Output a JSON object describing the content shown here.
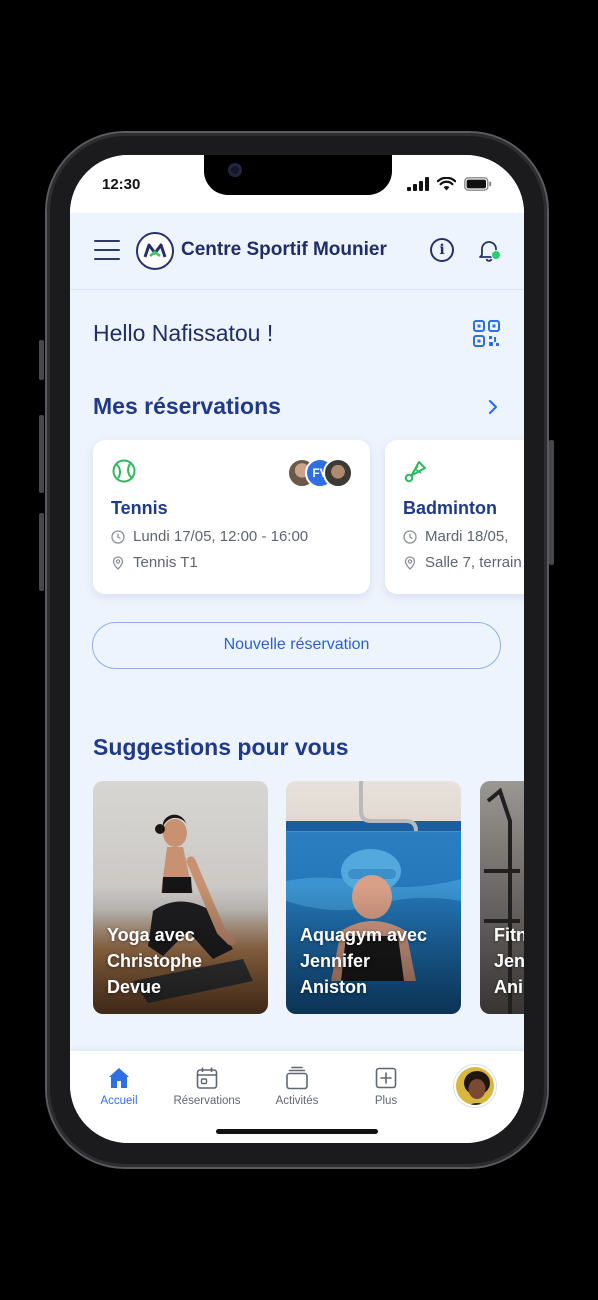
{
  "status": {
    "time": "12:30"
  },
  "header": {
    "brand": "Centre Sportif Mounier"
  },
  "greeting": "Hello Nafissatou !",
  "reservations": {
    "title": "Mes réservations",
    "cards": [
      {
        "sport": "Tennis",
        "date": "Lundi 17/05, 12:00 - 16:00",
        "location": "Tennis T1",
        "icon": "tennis-ball-icon",
        "participant_initials": "FV"
      },
      {
        "sport": "Badminton",
        "date": "Mardi 18/05,",
        "location": "Salle 7, terrain",
        "icon": "shuttlecock-icon"
      }
    ],
    "new_button": "Nouvelle réservation"
  },
  "suggestions": {
    "title": "Suggestions pour vous",
    "items": [
      {
        "label": "Yoga avec\nChristophe\nDevue"
      },
      {
        "label": "Aquagym avec\nJennifer\nAniston"
      },
      {
        "label": "Fitn\nJen\nAni"
      }
    ]
  },
  "tabbar": {
    "tabs": [
      {
        "label": "Accueil",
        "icon": "home-icon",
        "active": true
      },
      {
        "label": "Réservations",
        "icon": "calendar-icon"
      },
      {
        "label": "Activités",
        "icon": "stack-icon"
      },
      {
        "label": "Plus",
        "icon": "plus-square-icon"
      }
    ]
  },
  "colors": {
    "accent": "#2f6fe4",
    "navy": "#1f2d68",
    "title": "#1f3a8a",
    "notification_dot": "#2ecc71",
    "background": "#eef4fd"
  }
}
